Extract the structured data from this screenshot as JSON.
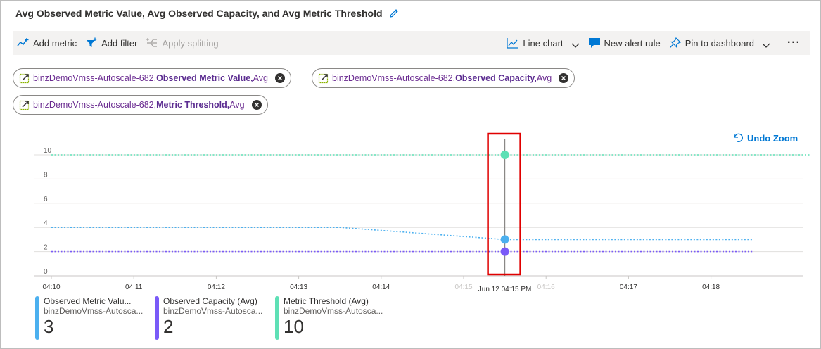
{
  "header": {
    "title": "Avg Observed Metric Value, Avg Observed Capacity, and Avg Metric Threshold"
  },
  "toolbar": {
    "add_metric": "Add metric",
    "add_filter": "Add filter",
    "apply_splitting": "Apply splitting",
    "line_chart": "Line chart",
    "new_alert_rule": "New alert rule",
    "pin_to_dashboard": "Pin to dashboard",
    "more": "···"
  },
  "pills": [
    {
      "resource": "binzDemoVmss-Autoscale-682, ",
      "metric": "Observed Metric Value,",
      "agg": " Avg"
    },
    {
      "resource": "binzDemoVmss-Autoscale-682, ",
      "metric": "Observed Capacity,",
      "agg": " Avg"
    },
    {
      "resource": "binzDemoVmss-Autoscale-682, ",
      "metric": "Metric Threshold,",
      "agg": " Avg"
    }
  ],
  "undo_zoom": "Undo Zoom",
  "colors": {
    "metric_value": "#4cb0ef",
    "capacity": "#7a5af8",
    "threshold": "#5ee0b5",
    "highlight": "#e00000",
    "accent": "#0078d4"
  },
  "chart_data": {
    "type": "line",
    "x_ticks": [
      "04:10",
      "04:11",
      "04:12",
      "04:13",
      "04:14",
      "04:15",
      "04:16",
      "04:17",
      "04:18"
    ],
    "y_ticks": [
      "0",
      "2",
      "4",
      "6",
      "8",
      "10"
    ],
    "ylim": [
      0,
      10
    ],
    "hover_label": "Jun 12 04:15 PM",
    "hover_time": 15.5,
    "x_range": [
      10,
      19.2
    ],
    "series": [
      {
        "name": "Observed Metric Value (Avg)",
        "color": "#4cb0ef",
        "points": [
          [
            10,
            4
          ],
          [
            13.5,
            4
          ],
          [
            15.5,
            3
          ],
          [
            18.5,
            3
          ]
        ]
      },
      {
        "name": "Observed Capacity (Avg)",
        "color": "#7a5af8",
        "points": [
          [
            10,
            2
          ],
          [
            18.5,
            2
          ]
        ]
      },
      {
        "name": "Metric Threshold (Avg)",
        "color": "#5ee0b5",
        "points": [
          [
            10,
            10
          ],
          [
            19.2,
            10
          ]
        ]
      }
    ],
    "markers": [
      {
        "series": "Metric Threshold (Avg)",
        "x": 15.5,
        "y": 10,
        "color": "#5ee0b5"
      },
      {
        "series": "Observed Metric Value (Avg)",
        "x": 15.5,
        "y": 3,
        "color": "#4cb0ef"
      },
      {
        "series": "Observed Capacity (Avg)",
        "x": 15.5,
        "y": 2,
        "color": "#7a5af8"
      }
    ]
  },
  "legend": [
    {
      "name": "Observed Metric Valu...",
      "sub": "binzDemoVmss-Autosca...",
      "value": "3",
      "color": "#4cb0ef"
    },
    {
      "name": "Observed Capacity (Avg)",
      "sub": "binzDemoVmss-Autosca...",
      "value": "2",
      "color": "#7a5af8"
    },
    {
      "name": "Metric Threshold (Avg)",
      "sub": "binzDemoVmss-Autosca...",
      "value": "10",
      "color": "#5ee0b5"
    }
  ]
}
